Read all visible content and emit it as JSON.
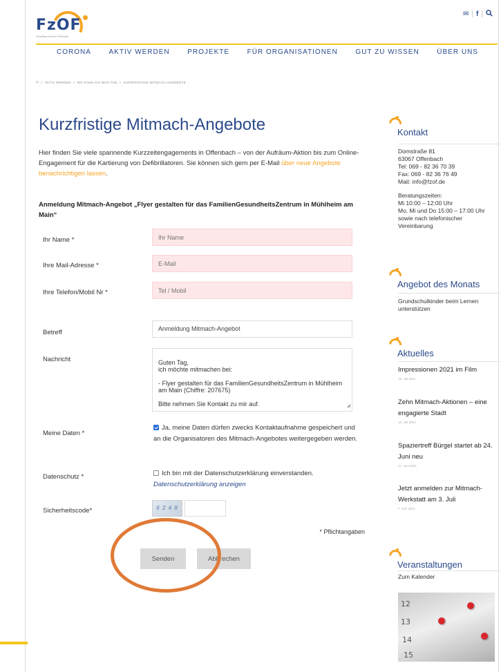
{
  "header": {
    "logo_text": "FzOF",
    "logo_subtitle": "Freiwilligenzentrum Offenbach",
    "icons": [
      "mail-icon",
      "facebook-icon",
      "search-icon"
    ]
  },
  "nav": {
    "items": [
      "CORONA",
      "AKTIV WERDEN",
      "PROJEKTE",
      "FÜR ORGANISATIONEN",
      "GUT ZU WISSEN",
      "ÜBER UNS"
    ]
  },
  "breadcrumb": {
    "items": [
      "AKTIV WERDEN",
      "WO KANN ICH WAS TUN",
      "KURZFRISTIGE MITMACH-ANGEBOTE"
    ],
    "separator": ">"
  },
  "main": {
    "title": "Kurzfristige Mitmach-Angebote",
    "intro_text": "Hier finden Sie viele spannende Kurzzeitengagements in Offenbach – von der Aufräum-Aktion bis zum Online-Engagement für die Kartierung von Defibrillatoren. Sie können sich gern per E-Mail ",
    "intro_link": "über neue Angebote benachrichtigen lassen",
    "intro_end": ".",
    "form_heading": "Anmeldung Mitmach-Angebot „Flyer gestalten für das FamilienGesundheitsZentrum in Mühlheim am Main“"
  },
  "form": {
    "name_label": "Ihr Name *",
    "name_placeholder": "Ihr Name",
    "email_label": "Ihre Mail-Adresse *",
    "email_placeholder": "E-Mail",
    "phone_label": "Ihre Telefon/Mobil Nr *",
    "phone_placeholder": "Tel / Mobil",
    "subject_label": "Betreff",
    "subject_value": "Anmeldung Mitmach-Angebot",
    "message_label": "Nachricht",
    "message_value": "Guten Tag,\nich möchte mitmachen bei:\n\n- Flyer gestalten für das FamilienGesundheitsZentrum in Mühlheim am Main (Chiffre: 207675)\n\nBitte nehmen Sie Kontakt zu mir auf.",
    "mydata_label": "Meine Daten *",
    "mydata_text": "Ja, meine Daten dürfen zwecks Kontaktaufnahme gespeichert und an die Organisatoren des Mitmach-Angebotes weitergegeben werden.",
    "mydata_checked": true,
    "privacy_label": "Datenschutz *",
    "privacy_text": "Ich bin mit der Datenschutzerklärung einverstanden.",
    "privacy_link": "Datenschutzerklärung anzeigen",
    "privacy_checked": false,
    "captcha_label": "Sicherheitscode*",
    "captcha_image_text": "6 2 4 8",
    "required_note": "* Pflichtangaben",
    "send_label": "Senden",
    "cancel_label": "Abbrechen",
    "highlight_color": "#e07a37"
  },
  "sidebar": {
    "contact": {
      "title": "Kontakt",
      "address": [
        "Domstraße 81",
        "63067 Offenbach",
        "Tel: 069 - 82 36 70 39",
        "Fax: 069 - 82 36 76 49",
        "Mail: info@fzof.de"
      ],
      "hours": [
        "Beratungszeiten:",
        "Mi 10:00 – 12:00 Uhr",
        "Mo, Mi und Do 15:00 – 17:00 Uhr",
        "sowie nach telefonischer",
        "Vereinbarung"
      ]
    },
    "offer": {
      "title": "Angebot des Monats",
      "text": "Grundschulkinder beim Lernen unterstützen"
    },
    "news": {
      "title": "Aktuelles",
      "items": [
        {
          "title": "Impressionen 2021 im Film",
          "date": "15. Juli 2021"
        },
        {
          "title": "Zehn Mitmach-Aktionen – eine engagierte Stadt",
          "date": "12. Juli 2021"
        },
        {
          "title": "Spaziertreff Bürgel startet ab 24. Juni neu",
          "date": "17. Juni 2021"
        },
        {
          "title": "Jetzt anmelden zur Mitmach-Werkstatt am 3. Juli",
          "date": "7. Juni 2021"
        }
      ]
    },
    "events": {
      "title": "Veranstaltungen",
      "link": "Zum Kalender",
      "calendar_numbers": [
        "12",
        "13",
        "14",
        "15"
      ]
    }
  },
  "colors": {
    "brand_blue": "#2b4a8b",
    "brand_orange": "#f5a524",
    "accent_yellow": "#f5c518"
  }
}
